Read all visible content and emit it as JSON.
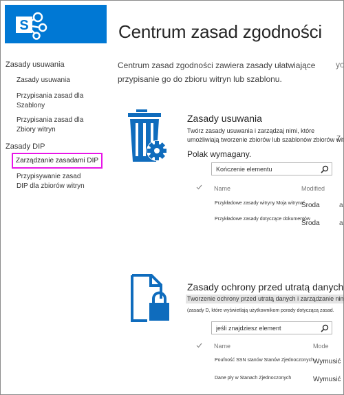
{
  "app": {
    "logo_letter": "S",
    "page_title": "Centrum zasad zgodności",
    "description": "Centrum zasad zgodności zawiera zasady ułatwiające przypisanie go do zbioru witryn lub szablonu.",
    "edge_text": "yo"
  },
  "nav": {
    "header1": "Zasady usuwania",
    "items1": [
      "Zasady usuwania",
      "Przypisania zasad dla Szablony",
      "Przypisania zasad dla Zbiory witryn"
    ],
    "header2": "Zasady DIP",
    "items2": [
      "Zarządzanie zasadami DIP",
      "Przypisywanie zasad DIP dla zbiorów witryn"
    ]
  },
  "retention": {
    "title": "Zasady usuwania",
    "description_line1": "Twórz zasady usuwania i zarządzaj nimi, które",
    "description_line2": "umożliwiają tworzenie zbiorów lub szablonów zbiorów witryn.",
    "description_cut": "Z",
    "required": "Polak wymagany.",
    "search_placeholder": "Kończenie elementu",
    "col_name": "Name",
    "col_modified": "Modified",
    "rows": [
      {
        "name": "Przykładowe zasady witryny Moja witryna",
        "modified": "Środa",
        "cut": "a"
      },
      {
        "name": "Przykładowe zasady dotyczące dokumentów",
        "modified": "Środa",
        "cut": "a"
      }
    ]
  },
  "dlp": {
    "title": "Zasady ochrony przed utratą danych",
    "description_line1": "Tworzenie ochrony przed utratą danych i zarządzanie nimi",
    "description_line2": "(zasady D, które wyświetlają użytkownikom porady dotyczącą zasad.",
    "search_placeholder": "jeśli znajdziesz element",
    "col_name": "Name",
    "col_mode": "Mode",
    "rows": [
      {
        "name": "Poufność SSN stanów Stanów Zjednoczonych",
        "mode": "Wymusić"
      },
      {
        "name": "Dane ply w Stanach Zjednoczonych",
        "mode": "Wymusić"
      }
    ]
  },
  "colors": {
    "brand": "#0078d4",
    "selection_outline": "#e815e8"
  },
  "icons": [
    "sharepoint-logo",
    "recycle-bin-gear-icon",
    "document-lock-icon",
    "search-icon",
    "checkmark-icon"
  ]
}
